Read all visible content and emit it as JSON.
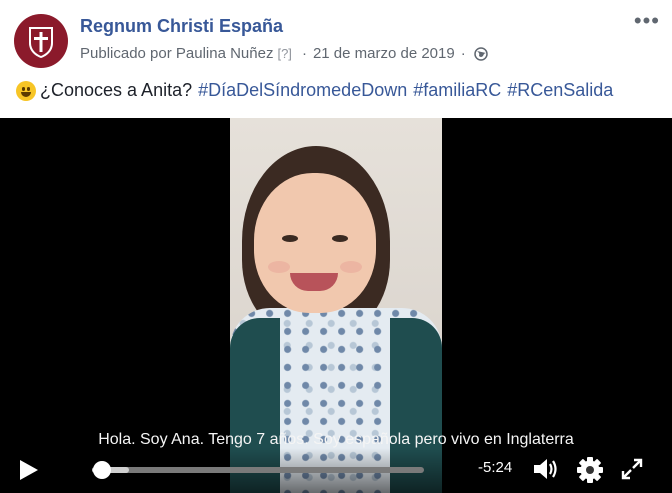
{
  "post": {
    "page_name": "Regnum Christi España",
    "published_by": "Publicado por Paulina Nuñez",
    "help_marker": "[?]",
    "separator": "·",
    "date": "21 de marzo de 2019",
    "text": "¿Conoces a Anita?",
    "hashtags": [
      "#DíaDelSíndromedeDown",
      "#familiaRC",
      "#RCenSalida"
    ]
  },
  "video": {
    "caption": "Hola. Soy Ana. Tengo 7 años. Soy española pero vivo en Inglaterra",
    "time_remaining": "-5:24",
    "progress": 0.03
  },
  "icons": {
    "avatar": "regnum-christi-logo",
    "more": "more-options-icon",
    "privacy": "globe-icon",
    "emoji": "grinning-face-emoji",
    "play": "play-icon",
    "volume": "volume-icon",
    "settings": "gear-icon",
    "fullscreen": "fullscreen-icon"
  },
  "colors": {
    "link": "#385898",
    "brand": "#8b1a2b",
    "meta": "#606770"
  }
}
